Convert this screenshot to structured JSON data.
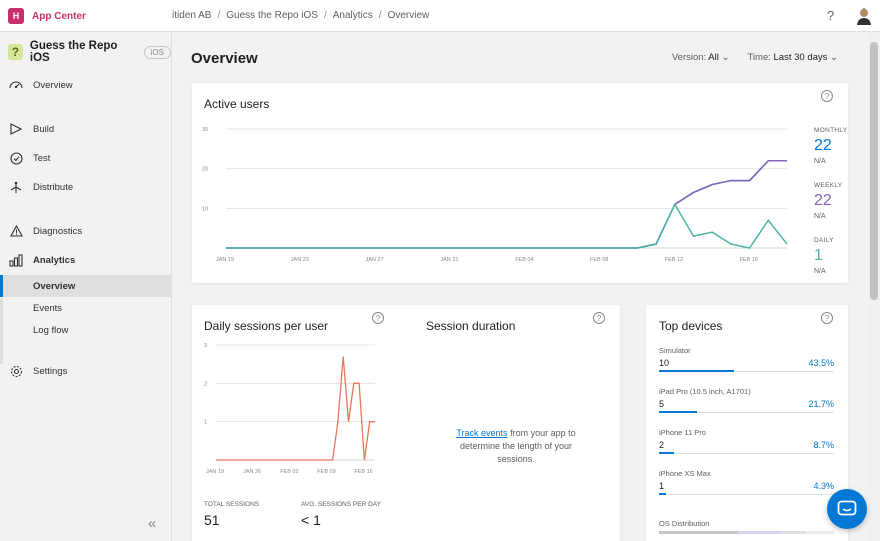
{
  "brand": {
    "name": "App Center",
    "logo_text": "H"
  },
  "breadcrumb": [
    "itiden AB",
    "Guess the Repo iOS",
    "Analytics",
    "Overview"
  ],
  "app": {
    "name": "Guess the Repo iOS",
    "os": "iOS",
    "icon_text": "?"
  },
  "sidebar": {
    "items": [
      {
        "label": "Overview",
        "icon": "overview-icon"
      },
      {
        "label": "Build",
        "icon": "build-icon"
      },
      {
        "label": "Test",
        "icon": "test-icon"
      },
      {
        "label": "Distribute",
        "icon": "distribute-icon"
      },
      {
        "label": "Diagnostics",
        "icon": "diagnostics-icon"
      },
      {
        "label": "Analytics",
        "icon": "analytics-icon"
      },
      {
        "label": "Settings",
        "icon": "settings-icon"
      }
    ],
    "analytics_sub": [
      "Overview",
      "Events",
      "Log flow"
    ]
  },
  "page": {
    "title": "Overview",
    "version_label": "Version:",
    "version_value": "All",
    "time_label": "Time:",
    "time_value": "Last 30 days"
  },
  "active_users": {
    "title": "Active users",
    "monthly_label": "MONTHLY",
    "monthly_value": "22",
    "monthly_na": "N/A",
    "weekly_label": "WEEKLY",
    "weekly_value": "22",
    "weekly_na": "N/A",
    "daily_label": "DAILY",
    "daily_value": "1",
    "daily_na": "N/A"
  },
  "sessions": {
    "title": "Daily sessions per user",
    "total_label": "TOTAL SESSIONS",
    "total_value": "51",
    "avg_label": "AVG. SESSIONS PER DAY",
    "avg_value": "< 1"
  },
  "session_duration": {
    "title": "Session duration",
    "link_text": "Track events",
    "text": "from your app to determine the length of your sessions."
  },
  "top_devices": {
    "title": "Top devices",
    "devices": [
      {
        "name": "Simulator",
        "count": "10",
        "pct": "43.5%",
        "share": 0.435
      },
      {
        "name": "iPad Pro (10.5 inch, A1701)",
        "count": "5",
        "pct": "21.7%",
        "share": 0.217
      },
      {
        "name": "iPhone 11 Pro",
        "count": "2",
        "pct": "8.7%",
        "share": 0.087
      },
      {
        "name": "iPhone XS Max",
        "count": "1",
        "pct": "4.3%",
        "share": 0.043
      }
    ],
    "os_label": "OS Distribution"
  },
  "colors": {
    "accent": "#0078d4",
    "brand": "#cb2e6d",
    "monthly": "#0078d4",
    "weekly": "#8764b8",
    "daily": "#4fb6a5",
    "sessions": "#e8765a"
  },
  "chart_data": [
    {
      "type": "line",
      "title": "Active users",
      "x": [
        "JAN 19",
        "JAN 20",
        "JAN 21",
        "JAN 22",
        "JAN 23",
        "JAN 24",
        "JAN 25",
        "JAN 26",
        "JAN 27",
        "JAN 28",
        "JAN 29",
        "JAN 30",
        "JAN 31",
        "FEB 01",
        "FEB 02",
        "FEB 03",
        "FEB 04",
        "FEB 05",
        "FEB 06",
        "FEB 07",
        "FEB 08",
        "FEB 09",
        "FEB 10",
        "FEB 11",
        "FEB 12",
        "FEB 13",
        "FEB 14",
        "FEB 15",
        "FEB 16",
        "FEB 17",
        "FEB 18"
      ],
      "xticks": [
        "JAN 19",
        "JAN 23",
        "JAN 27",
        "JAN 31",
        "FEB 04",
        "FEB 08",
        "FEB 12",
        "FEB 16"
      ],
      "ylim": [
        0,
        30
      ],
      "yticks": [
        10,
        20,
        30
      ],
      "grid": true,
      "series": [
        {
          "name": "MONTHLY",
          "values": [
            0,
            0,
            0,
            0,
            0,
            0,
            0,
            0,
            0,
            0,
            0,
            0,
            0,
            0,
            0,
            0,
            0,
            0,
            0,
            0,
            0,
            0,
            0,
            1,
            11,
            14,
            16,
            17,
            17,
            22,
            22
          ]
        },
        {
          "name": "WEEKLY",
          "values": [
            0,
            0,
            0,
            0,
            0,
            0,
            0,
            0,
            0,
            0,
            0,
            0,
            0,
            0,
            0,
            0,
            0,
            0,
            0,
            0,
            0,
            0,
            0,
            1,
            11,
            14,
            16,
            17,
            17,
            22,
            22
          ]
        },
        {
          "name": "DAILY",
          "values": [
            0,
            0,
            0,
            0,
            0,
            0,
            0,
            0,
            0,
            0,
            0,
            0,
            0,
            0,
            0,
            0,
            0,
            0,
            0,
            0,
            0,
            0,
            0,
            1,
            11,
            3,
            4,
            1,
            0,
            7,
            1
          ]
        }
      ]
    },
    {
      "type": "line",
      "title": "Daily sessions per user",
      "xticks": [
        "JAN 19",
        "JAN 26",
        "FEB 02",
        "FEB 09",
        "FEB 16"
      ],
      "ylim": [
        0,
        3
      ],
      "yticks": [
        1,
        2,
        3
      ],
      "grid": true,
      "values": [
        0,
        0,
        0,
        0,
        0,
        0,
        0,
        0,
        0,
        0,
        0,
        0,
        0,
        0,
        0,
        0,
        0,
        0,
        0,
        0,
        0,
        0,
        0,
        1,
        2.7,
        1,
        2,
        2,
        0,
        1,
        1
      ]
    }
  ]
}
